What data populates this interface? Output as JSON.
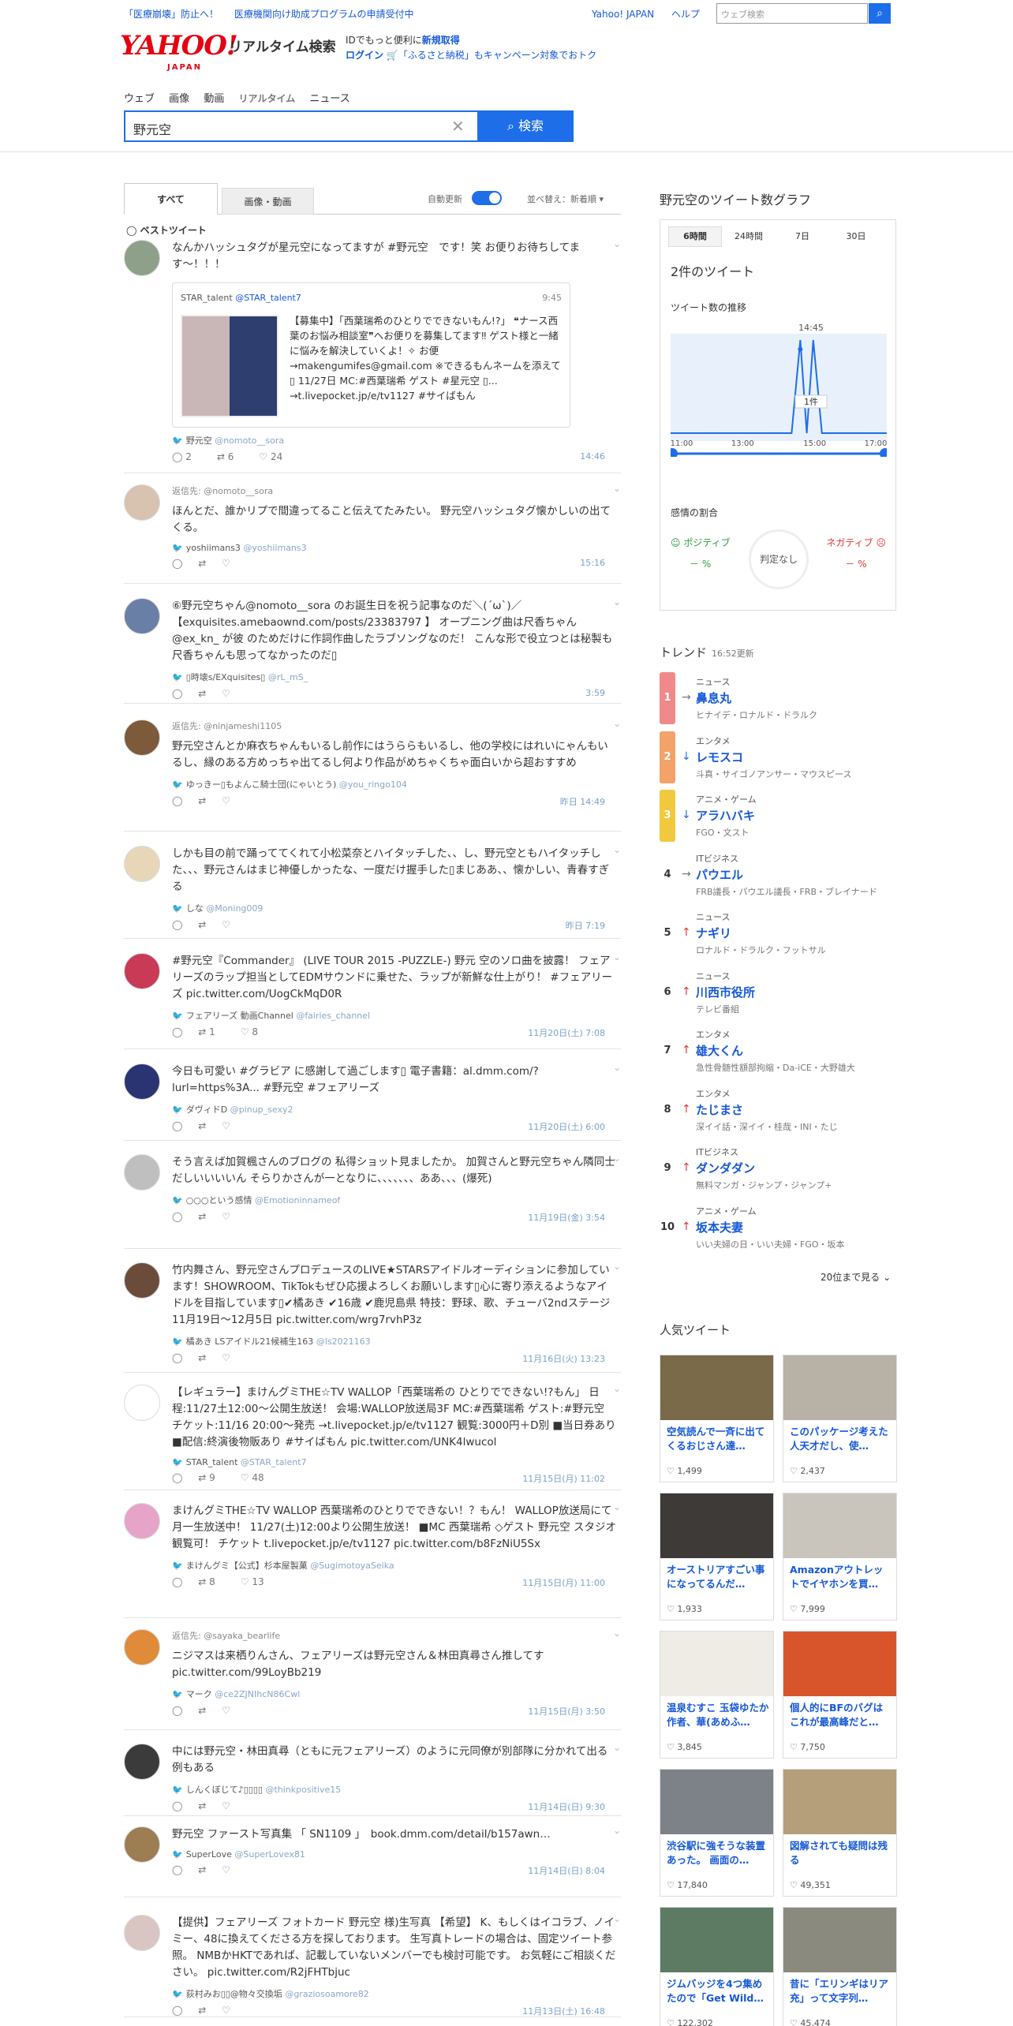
{
  "topbar": {
    "links": [
      "「医療崩壊」防止へ！",
      "医療機関向け助成プログラムの申請受付中"
    ],
    "yahoo": "Yahoo! JAPAN",
    "help": "ヘルプ",
    "search_placeholder": "ウェブ検索"
  },
  "header": {
    "logo": "YAHOO!",
    "logo_sub_small": "JAPAN",
    "title": "リアルタイム検索",
    "info1_pre": "IDでもっと便利に",
    "info1_link": "新規取得",
    "info2_link": "ログイン",
    "info2_text": "「ふるさと納税」もキャンペーン対象でおトク"
  },
  "nav": [
    "ウェブ",
    "画像",
    "動画",
    "リアルタイム",
    "ニュース"
  ],
  "search": {
    "query": "野元空",
    "button": "検索"
  },
  "tabs": {
    "all": "すべて",
    "media": "画像・動画",
    "auto_update": "自動更新",
    "sort": "並べ替え：新着順"
  },
  "best_label": "ベストツイート",
  "tweets": [
    {
      "reply": "",
      "text": "なんかハッシュタグが星元空になってますが #野元空　です！笑 お便りお待ちしてます〜！！！",
      "user": "野元空",
      "handle": "@nomoto__sora",
      "time": "14:46",
      "rt": "6",
      "like": "24",
      "reply_count": "2",
      "quote": {
        "name": "STAR_talent",
        "handle": "@STAR_talent7",
        "time": "9:45",
        "text": "【募集中】「西葉瑞希のひとりでできないもん!?」 ❝ナース西葉のお悩み相談室❞へお便りを募集してます‼︎ ゲスト様と一緒に悩みを解決していくよ！✧ お便→makengumifes@gmail.com ※できるもんネームを添えて▯ 11/27日 MC:#西葉瑞希 ゲスト #星元空 ▯... →t.livepocket.jp/e/tv1127 #サイばもん"
      }
    },
    {
      "reply": "返信先: @nomoto__sora",
      "text": "ほんとだ、誰かリプで間違ってること伝えてたみたい。 野元空ハッシュタグ懐かしいの出てくる。",
      "user": "yoshiimans3",
      "handle": "@yoshiimans3",
      "time": "15:16"
    },
    {
      "reply": "",
      "text": "⑥野元空ちゃん@nomoto__sora のお誕生日を祝う記事なのだ＼(ˊωˋ)／ 【exquisites.amebaownd.com/posts/23383797 】 オープニング曲は尺香ちゃん@ex_kn_ が彼 のためだけに作詞作曲したラブソングなのだ！ こんな形で役立つとは秘製も尺香ちゃんも思ってなかったのだ▯",
      "user": "▯時壊s/EXquisites▯",
      "handle": "@rL_mS_",
      "time": "3:59"
    },
    {
      "reply": "返信先: @ninjameshi1105",
      "text": "野元空さんとか麻衣ちゃんもいるし前作にはうららもいるし、他の学校にはれいにゃんもいるし、縁のある方めっちゃ出てるし何より作品がめちゃくちゃ面白いから超おすすめ",
      "user": "ゆっきー▯もよんこ騎士団(にゃいとう)",
      "handle": "@you_ringo104",
      "time": "昨日 14:49"
    },
    {
      "reply": "",
      "text": "しかも目の前で踊っててくれて小松菜奈とハイタッチした、、し、野元空ともハイタッチした、、、野元さんはまじ神優しかったな、一度だけ握手した▯まじああ、、懐かしい、青春すぎる",
      "user": "しな",
      "handle": "@Moning009",
      "time": "昨日 7:19"
    },
    {
      "reply": "",
      "text": "#野元空『Commander』 (LIVE TOUR 2015 -PUZZLE-) 野元 空のソロ曲を披露！ フェアリーズのラップ担当としてEDMサウンドに乗せた、ラップが新鮮な仕上がり！ #フェアリーズ pic.twitter.com/UogCkMqD0R",
      "user": "フェアリーズ 動画Channel",
      "handle": "@fairies_channel",
      "time": "11月20日(土) 7:08",
      "rt": "1",
      "like": "8"
    },
    {
      "reply": "",
      "text": "今日も可愛い #グラビア に感謝して過ごします▯ 電子書籍：al.dmm.com/?lurl=https%3A... #野元空 #フェアリーズ",
      "user": "ダヴィドD",
      "handle": "@pinup_sexy2",
      "time": "11月20日(土) 6:00"
    },
    {
      "reply": "",
      "text": "そう言えば加賀楓さんのブログの 私得ショット見ましたか。 加賀さんと野元空ちゃん隣同士だしいいいいん そらりかさんが一となりに、、、、、、、ああ、、、(爆死)",
      "user": "○○○という感情",
      "handle": "@Emotioninnameof",
      "time": "11月19日(金) 3:54"
    },
    {
      "reply": "",
      "text": "竹内舞さん、野元空さんプロデュースのLIVE★STARSアイドルオーディションに参加しています！SHOWROOM、TikTokもぜひ応援よろしくお願いします▯心に寄り添えるようなアイドルを目指しています▯✔橘あき ✔16歳 ✔鹿児島県 特技：野球、歌、チューバ2ndステージ 11月19日〜12月5日 pic.twitter.com/wrg7rvhP3z",
      "user": "橘あき LSアイドル21候補生163",
      "handle": "@ls2021163",
      "time": "11月16日(火) 13:23"
    },
    {
      "reply": "",
      "text": "【レギュラー】まけんグミTHE☆TV WALLOP「西葉瑞希の ひとりでできない!?もん」 日程:11/27土12:00〜公開生放送！ 会場:WALLOP放送局3F MC:#西葉瑞希 ゲスト:#野元空 チケット:11/16 20:00〜発売 →t.livepocket.jp/e/tv1127 観覧:3000円＋D別 ■当日券あり ■配信:終演後物販あり #サイばもん pic.twitter.com/UNK4lwucol",
      "user": "STAR_talent",
      "handle": "@STAR_talent7",
      "time": "11月15日(月) 11:02",
      "rt": "9",
      "like": "48"
    },
    {
      "reply": "",
      "text": "まけんグミTHE☆TV WALLOP 西葉瑞希のひとりでできない！？もん！ WALLOP放送局にて月一生放送中！ 11/27(土)12:00より公開生放送！ ■MC 西葉瑞希 ◇ゲスト 野元空 スタジオ観覧可！ チケット t.livepocket.jp/e/tv1127 pic.twitter.com/b8FzNiU5Sx",
      "user": "まけんグミ【公式】杉本屋製菓",
      "handle": "@SugimotoyaSeika",
      "time": "11月15日(月) 11:00",
      "rt": "8",
      "like": "13"
    },
    {
      "reply": "返信先: @sayaka_bearlife",
      "text": "ニジマスは来栖りんさん、フェアリーズは野元空さん＆林田真尋さん推してす pic.twitter.com/99LoyBb219",
      "user": "マーク",
      "handle": "@ce2ZJNIhcN86Cwl",
      "time": "11月15日(月) 3:50"
    },
    {
      "reply": "",
      "text": "中には野元空・林田真尋（ともに元フェアリーズ）のように元同僚が別部隊に分かれて出る例もある",
      "user": "しんくぼじて♪▯▯▯▯",
      "handle": "@thinkpositive15",
      "time": "11月14日(日) 9:30"
    },
    {
      "reply": "",
      "text": "野元空 ファースト写真集 「 SN1109 」　book.dmm.com/detail/b157awn…",
      "user": "SuperLove",
      "handle": "@SuperLovex81",
      "time": "11月14日(日) 8:04"
    },
    {
      "reply": "",
      "text": "【提供】フェアリーズ フォトカード 野元空 様)生写真 【希望】 K、もしくはイコラブ、ノイミー、48に換えてくださる方を探しております。 生写真トレードの場合は、固定ツイート参照。 NMBかHKTであれば、記載していないメンバーでも検討可能です。 お気軽にご相談ください。 pic.twitter.com/R2jFHTbjuc",
      "user": "荻村みお▯▯@物々交換垢",
      "handle": "@graziosoamore82",
      "time": "11月13日(土) 16:48"
    }
  ],
  "graph": {
    "title": "野元空のツイート数グラフ",
    "tabs": [
      "6時間",
      "24時間",
      "7日",
      "30日"
    ],
    "count": "2件のツイート",
    "sub": "ツイート数の推移",
    "peak_time": "14:45",
    "peak_label": "1件",
    "xticks": [
      "11:00",
      "13:00",
      "15:00",
      "17:00"
    ],
    "sentiment": "感情の割合",
    "positive": "ポジティブ",
    "negative": "ネガティブ",
    "pos_val": "－ %",
    "neg_val": "－ %",
    "judge": "判定なし"
  },
  "chart_data": {
    "type": "line",
    "x": [
      "11:00",
      "13:00",
      "14:45",
      "15:00",
      "17:00"
    ],
    "values": [
      0,
      0,
      1,
      1,
      0
    ]
  },
  "trend": {
    "title": "トレンド",
    "updated": "16:52更新",
    "more": "20位まで見る",
    "items": [
      {
        "rank": "1",
        "cat": "ニュース",
        "kw": "鼻息丸",
        "rel": "ヒナイデ・ロナルド・ドラルク",
        "arrow": "→",
        "color": "#f08a8a"
      },
      {
        "rank": "2",
        "cat": "エンタメ",
        "kw": "レモスコ",
        "rel": "斗真・サイゴノアンサー・マウスピース",
        "arrow": "↓",
        "color": "#f3a268"
      },
      {
        "rank": "3",
        "cat": "アニメ・ゲーム",
        "kw": "アラハバキ",
        "rel": "FGO・文スト",
        "arrow": "↓",
        "color": "#f2c93e"
      },
      {
        "rank": "4",
        "cat": "ITビジネス",
        "kw": "パウエル",
        "rel": "FRB議長・パウエル議長・FRB・ブレイナード",
        "arrow": "→",
        "color": ""
      },
      {
        "rank": "5",
        "cat": "ニュース",
        "kw": "ナギリ",
        "rel": "ロナルド・ドラルク・フットサル",
        "arrow": "↑",
        "color": ""
      },
      {
        "rank": "6",
        "cat": "ニュース",
        "kw": "川西市役所",
        "rel": "テレビ番組",
        "arrow": "↑",
        "color": ""
      },
      {
        "rank": "7",
        "cat": "エンタメ",
        "kw": "雄大くん",
        "rel": "急性骨髄性額部拘縮・Da-iCE・大野雄大",
        "arrow": "↑",
        "color": ""
      },
      {
        "rank": "8",
        "cat": "エンタメ",
        "kw": "たじまさ",
        "rel": "深イイ話・深イイ・桂哉・INI・たじ",
        "arrow": "↑",
        "color": ""
      },
      {
        "rank": "9",
        "cat": "ITビジネス",
        "kw": "ダンダダン",
        "rel": "無料マンガ・ジャンプ・ジャンプ+",
        "arrow": "↑",
        "color": ""
      },
      {
        "rank": "10",
        "cat": "アニメ・ゲーム",
        "kw": "坂本夫妻",
        "rel": "いい夫婦の日・いい夫婦・FGO・坂本",
        "arrow": "↑",
        "color": ""
      }
    ]
  },
  "popular": {
    "title": "人気ツイート",
    "items": [
      {
        "t": "空気読んで一斉に出てくるおじさん達…",
        "likes": "1,499",
        "bg": "#7a6a4a"
      },
      {
        "t": "このパッケージ考えた人天才だし、使…",
        "likes": "2,437",
        "bg": "#b7b1a6"
      },
      {
        "t": "オーストリアすごい事になってるんだ…",
        "likes": "1,933",
        "bg": "#3e3a38"
      },
      {
        "t": "Amazonアウトレットでイヤホンを買…",
        "likes": "7,999",
        "bg": "#c9c4bc"
      },
      {
        "t": "温泉むすこ 玉袋ゆたか作者、華(あめふ…",
        "likes": "3,845",
        "bg": "#efece6"
      },
      {
        "t": "個人的にBFのバグはこれが最高峰だと…",
        "likes": "7,750",
        "bg": "#d8542a"
      },
      {
        "t": "渋谷駅に強そうな装置あった。 画面の…",
        "likes": "17,840",
        "bg": "#7d8288"
      },
      {
        "t": "図解されても疑問は残る",
        "likes": "49,351",
        "bg": "#b59e7a"
      },
      {
        "t": "ジムバッジを4つ集めたので「Get Wild…",
        "likes": "122,302",
        "bg": "#5d7a63"
      },
      {
        "t": "昔に「エリンギはリア充」って文字列…",
        "likes": "45,474",
        "bg": "#8a8a7e"
      }
    ]
  }
}
